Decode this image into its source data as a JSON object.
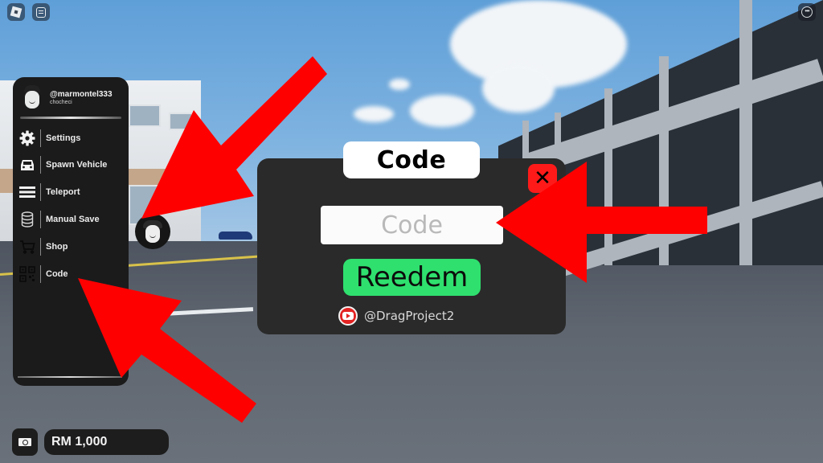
{
  "top_bar": {
    "roblox_menu_icon": "roblox-logo-icon",
    "chat_icon": "chat-icon",
    "more_icon": "more-options-icon",
    "more_glyph": "•••"
  },
  "side_menu": {
    "profile": {
      "username": "@marmontel333",
      "display_name": "chocheci"
    },
    "items": [
      {
        "label": "Settings",
        "icon": "gear-icon"
      },
      {
        "label": "Spawn Vehicle",
        "icon": "car-icon"
      },
      {
        "label": "Teleport",
        "icon": "menu-lines-icon"
      },
      {
        "label": "Manual Save",
        "icon": "database-icon"
      },
      {
        "label": "Shop",
        "icon": "cart-icon"
      },
      {
        "label": "Code",
        "icon": "qr-code-icon"
      }
    ]
  },
  "code_dialog": {
    "title": "Code",
    "close_glyph": "✕",
    "input_placeholder": "Code",
    "input_value": "",
    "redeem_label": "Reedem",
    "youtube_handle": "@DragProject2",
    "colors": {
      "panel": "#2a2a2a",
      "close": "#ff1a1a",
      "redeem": "#2fe06e",
      "youtube": "#e32222"
    }
  },
  "money": {
    "amount_label": "RM 1,000",
    "icon": "cash-icon"
  },
  "annotations": {
    "arrow_color": "#ff0000",
    "arrow_count": 3
  }
}
